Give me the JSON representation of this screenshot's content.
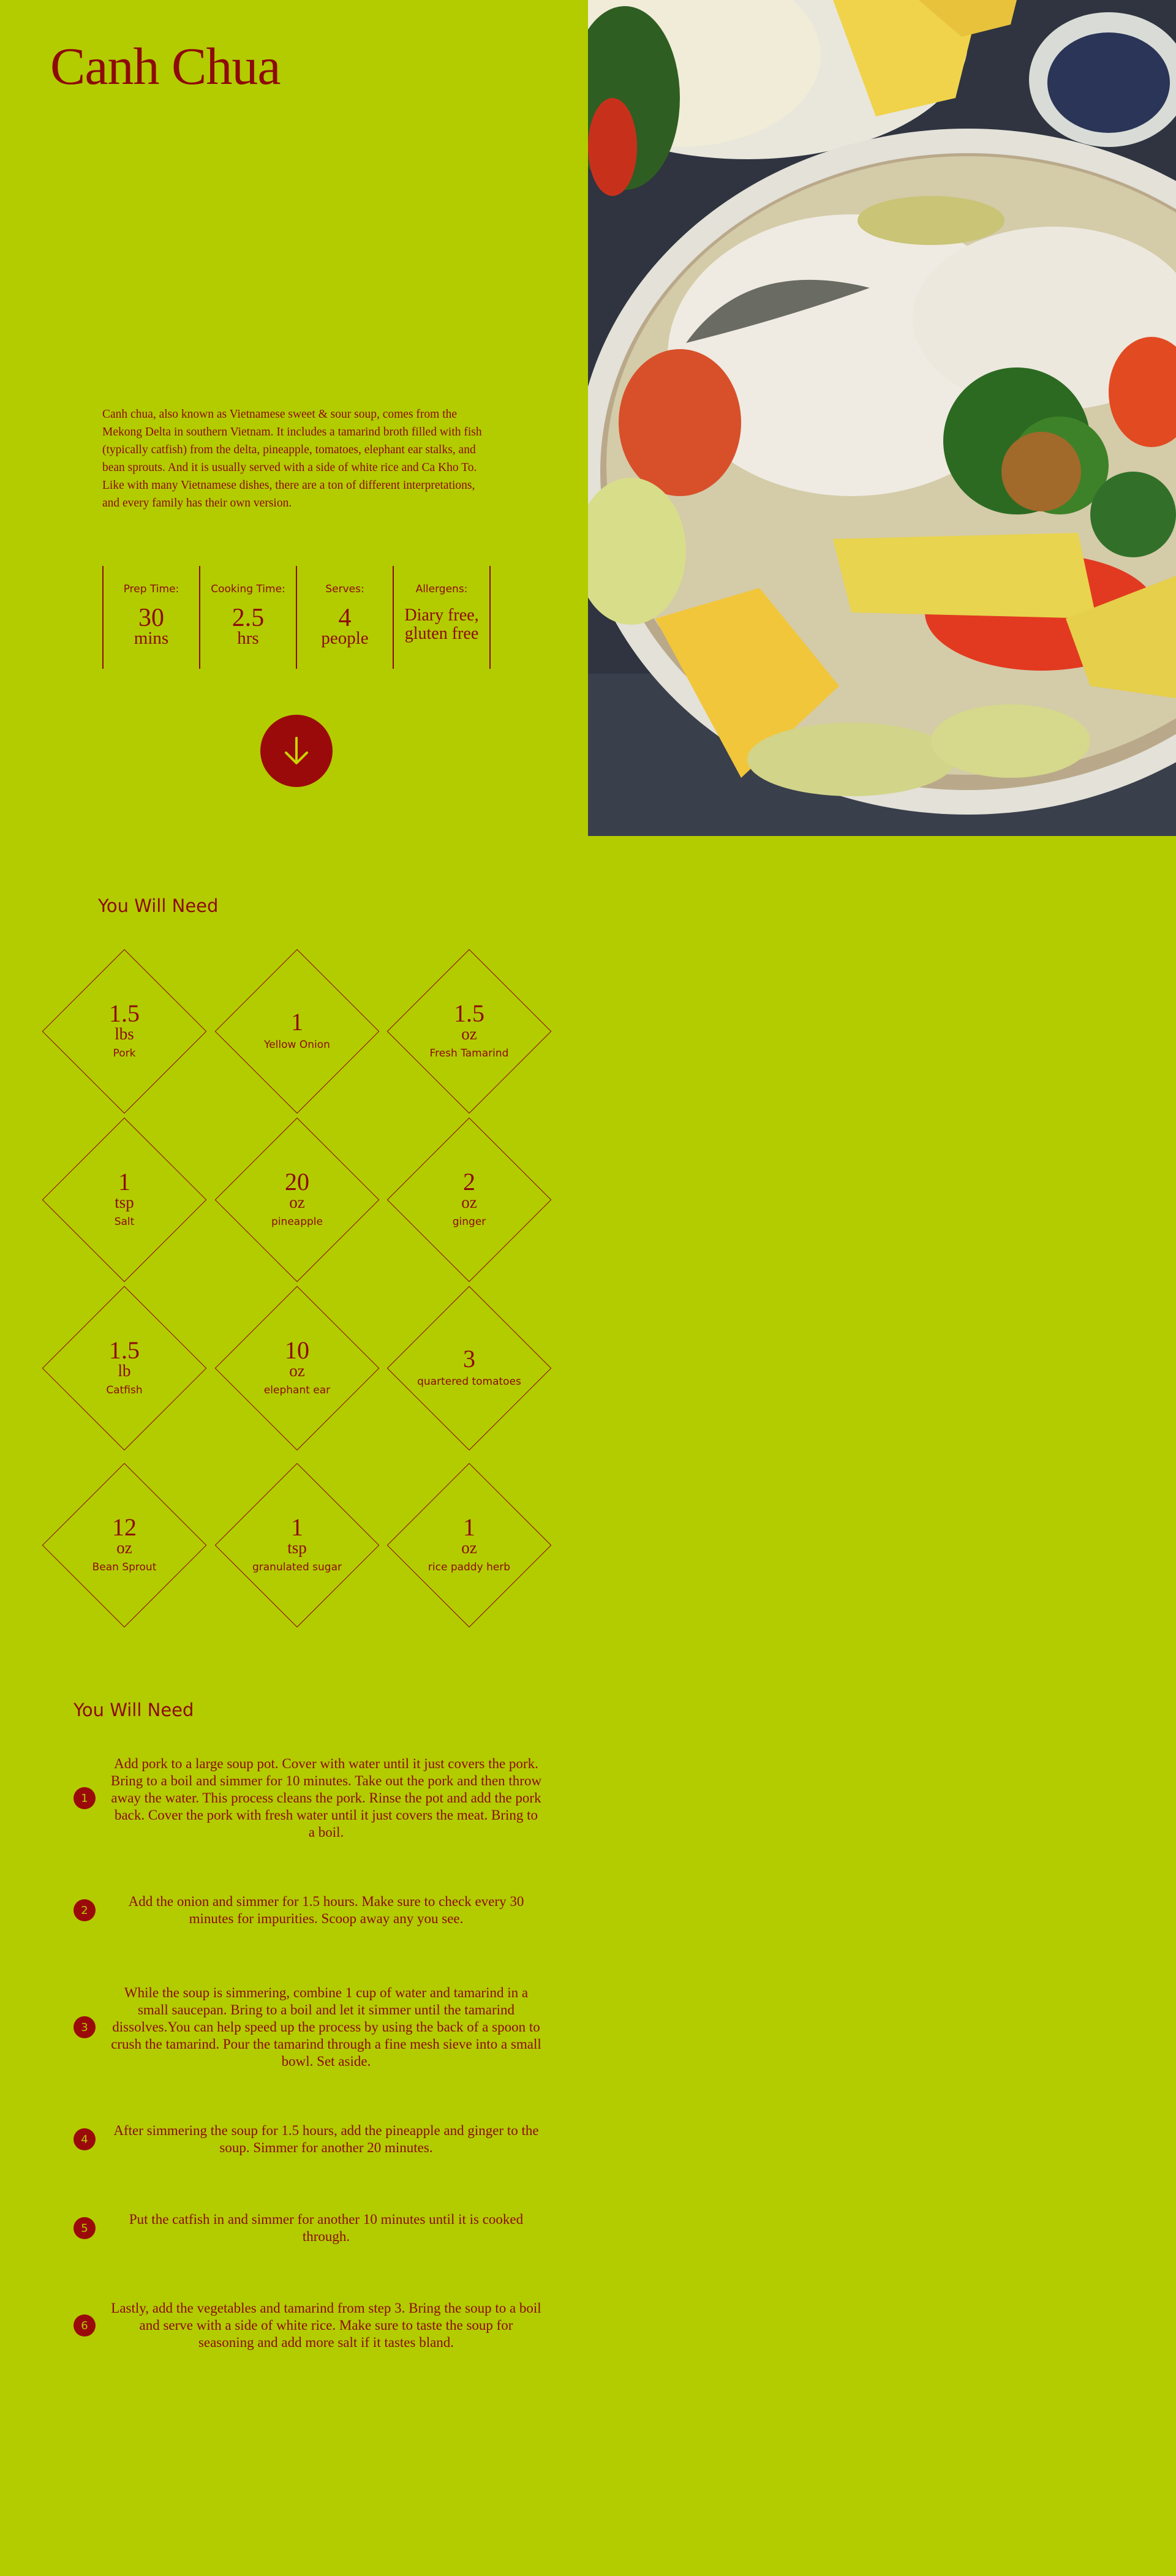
{
  "hero": {
    "title": "Canh Chua",
    "description": "Canh chua, also known as Vietnamese sweet & sour soup, comes from the Mekong Delta in southern Vietnam. It includes a tamarind broth filled with fish (typically catfish) from the delta, pineapple, tomatoes, elephant ear stalks, and bean sprouts. And it is usually served with a side of white rice and Ca Kho To. Like with many Vietnamese dishes, there are a ton of different interpretations, and every family has their own version.",
    "stats": [
      {
        "label": "Prep Time:",
        "value": "30",
        "unit": "mins"
      },
      {
        "label": "Cooking Time:",
        "value": "2.5",
        "unit": "hrs"
      },
      {
        "label": "Serves:",
        "value": "4",
        "unit": "people"
      },
      {
        "label": "Allergens:",
        "text": "Diary free, gluten free"
      }
    ],
    "scroll_icon": "arrow-down-icon",
    "photo_alt": "canh-chua-soup-photo"
  },
  "ingredients": {
    "title": "You Will Need",
    "items": [
      {
        "qty": "1.5",
        "unit": "lbs",
        "name": "Pork"
      },
      {
        "qty": "1",
        "unit": "",
        "name": "Yellow Onion"
      },
      {
        "qty": "1.5",
        "unit": "oz",
        "name": "Fresh Tamarind"
      },
      {
        "qty": "1",
        "unit": "tsp",
        "name": "Salt"
      },
      {
        "qty": "20",
        "unit": "oz",
        "name": "pineapple"
      },
      {
        "qty": "2",
        "unit": "oz",
        "name": "ginger"
      },
      {
        "qty": "1.5",
        "unit": "lb",
        "name": "Catfish"
      },
      {
        "qty": "10",
        "unit": "oz",
        "name": "elephant ear"
      },
      {
        "qty": "3",
        "unit": "",
        "name": "quartered tomatoes"
      },
      {
        "qty": "12",
        "unit": "oz",
        "name": "Bean Sprout"
      },
      {
        "qty": "1",
        "unit": "tsp",
        "name": "granulated sugar"
      },
      {
        "qty": "1",
        "unit": "oz",
        "name": "rice paddy herb"
      }
    ]
  },
  "directions": {
    "title": "You Will Need",
    "steps": [
      {
        "num": "1",
        "text": "Add pork to a large soup pot. Cover with water until it just covers the pork. Bring to a boil and simmer for 10 minutes. Take out the pork and then throw away the water. This process cleans the pork. Rinse the pot and add the pork back. Cover the pork with fresh water until it just covers the meat. Bring to a boil."
      },
      {
        "num": "2",
        "text": "Add the onion and simmer for 1.5 hours. Make sure to check every 30 minutes for impurities. Scoop away any you see."
      },
      {
        "num": "3",
        "text": "While the soup is simmering, combine 1 cup of water and tamarind in a small saucepan. Bring to a boil and let it simmer until the tamarind dissolves.You can help speed up the process by using the back of a spoon to crush the tamarind. Pour the tamarind through a fine mesh sieve into a small bowl. Set aside."
      },
      {
        "num": "4",
        "text": "After simmering the soup for 1.5 hours, add the pineapple and ginger to the soup. Simmer for another 20 minutes."
      },
      {
        "num": "5",
        "text": "Put the catfish in and simmer for another 10 minutes until it is cooked through."
      },
      {
        "num": "6",
        "text": "Lastly, add the vegetables and tamarind from step 3. Bring the soup to a boil and serve with a side of white rice. Make sure to taste the soup for seasoning and add more salt if it tastes bland."
      }
    ]
  },
  "colors": {
    "background": "#b2cc00",
    "accent": "#8e0a0a",
    "button": "#9b0a0a"
  }
}
